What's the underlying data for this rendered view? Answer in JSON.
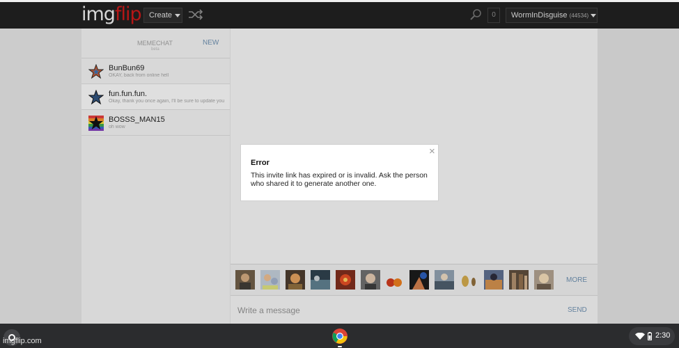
{
  "topbar": {
    "logo_main": "img",
    "logo_accent": "flip",
    "create_label": "Create",
    "notifications_count": "0",
    "username": "WormInDisguise",
    "user_points": "(44534)"
  },
  "sidebar": {
    "title": "MEMECHAT",
    "subtitle": "beta",
    "new_label": "NEW",
    "conversations": [
      {
        "name": "BunBun69",
        "preview": "OKAY, back from online hell"
      },
      {
        "name": "fun.fun.fun.",
        "preview": "Okay, thank you once again, I'll be sure to update you"
      },
      {
        "name": "BOSSS_MAN15",
        "preview": "oh wow"
      }
    ]
  },
  "stickers": {
    "more_label": "MORE",
    "items": [
      "sticker-1",
      "sticker-2",
      "sticker-3",
      "sticker-4",
      "sticker-5",
      "sticker-6",
      "sticker-7",
      "sticker-8",
      "sticker-9",
      "sticker-10",
      "sticker-11",
      "sticker-12",
      "sticker-13"
    ]
  },
  "compose": {
    "placeholder": "Write a message",
    "send_label": "SEND"
  },
  "modal": {
    "title": "Error",
    "message": "This invite link has expired or is invalid. Ask the person who shared it to generate another one.",
    "close_glyph": "×"
  },
  "shelf": {
    "url": "imgflip.com",
    "time": "2:30"
  },
  "colors": {
    "topbar_bg": "#1f1f1f",
    "logo_accent": "#c21818",
    "link_blue": "#6a8aa8",
    "shelf_bg": "#2b2c2e"
  }
}
